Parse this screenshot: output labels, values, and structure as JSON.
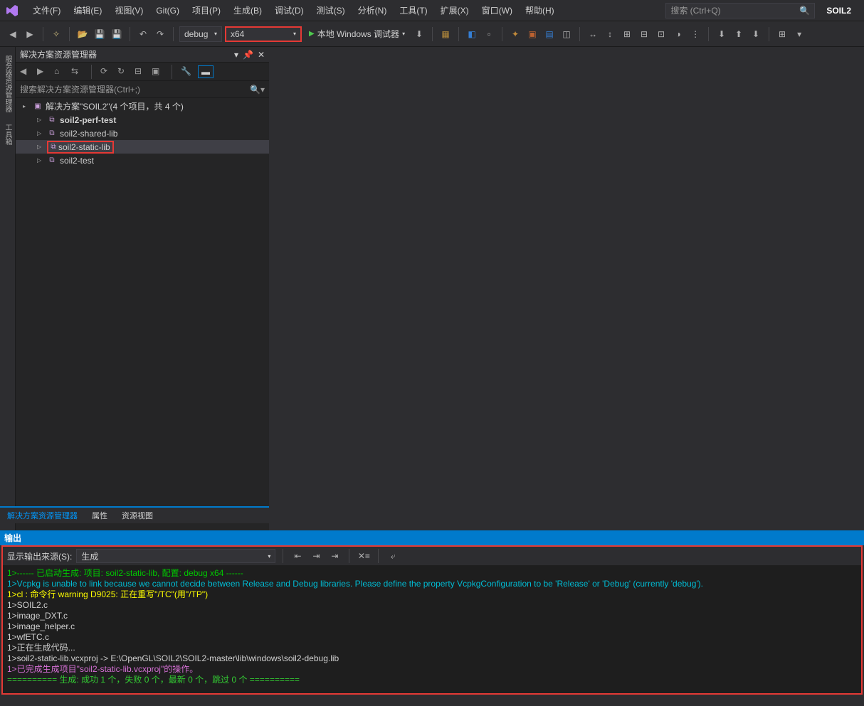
{
  "menu": {
    "items": [
      "文件(F)",
      "编辑(E)",
      "视图(V)",
      "Git(G)",
      "项目(P)",
      "生成(B)",
      "调试(D)",
      "测试(S)",
      "分析(N)",
      "工具(T)",
      "扩展(X)",
      "窗口(W)",
      "帮助(H)"
    ]
  },
  "search": {
    "placeholder": "搜索 (Ctrl+Q)"
  },
  "solution_name": "SOIL2",
  "toolbar": {
    "config": "debug",
    "platform": "x64",
    "run_label": "本地 Windows 调试器"
  },
  "left_tabs": [
    "服务器资源管理器",
    "工具箱"
  ],
  "panel": {
    "title": "解决方案资源管理器",
    "search_placeholder": "搜索解决方案资源管理器(Ctrl+;)",
    "root": "解决方案\"SOIL2\"(4 个项目，共 4 个)",
    "projects": [
      "soil2-perf-test",
      "soil2-shared-lib",
      "soil2-static-lib",
      "soil2-test"
    ]
  },
  "bottom_tabs": [
    "解决方案资源管理器",
    "属性",
    "资源视图"
  ],
  "output": {
    "header": "输出",
    "source_label": "显示输出来源(S):",
    "source_value": "生成",
    "lines": [
      {
        "cls": "c-green",
        "text": "1>------ 已启动生成: 项目: soil2-static-lib, 配置: debug x64 ------"
      },
      {
        "cls": "c-cyan",
        "text": "1>Vcpkg is unable to link because we cannot decide between Release and Debug libraries. Please define the property VcpkgConfiguration to be 'Release' or 'Debug' (currently 'debug')."
      },
      {
        "cls": "c-yellow",
        "text": "1>cl : 命令行 warning D9025: 正在重写\"/TC\"(用\"/TP\")"
      },
      {
        "cls": "c-white",
        "text": "1>SOIL2.c"
      },
      {
        "cls": "c-white",
        "text": "1>image_DXT.c"
      },
      {
        "cls": "c-white",
        "text": "1>image_helper.c"
      },
      {
        "cls": "c-white",
        "text": "1>wfETC.c"
      },
      {
        "cls": "c-white",
        "text": "1>正在生成代码..."
      },
      {
        "cls": "c-white",
        "text": "1>soil2-static-lib.vcxproj -> E:\\OpenGL\\SOIL2\\SOIL2-master\\lib\\windows\\soil2-debug.lib"
      },
      {
        "cls": "c-magenta",
        "text": "1>已完成生成项目\"soil2-static-lib.vcxproj\"的操作。"
      },
      {
        "cls": "c-lime",
        "text": "========== 生成: 成功 1 个，失败 0 个，最新 0 个，跳过 0 个 =========="
      }
    ]
  }
}
